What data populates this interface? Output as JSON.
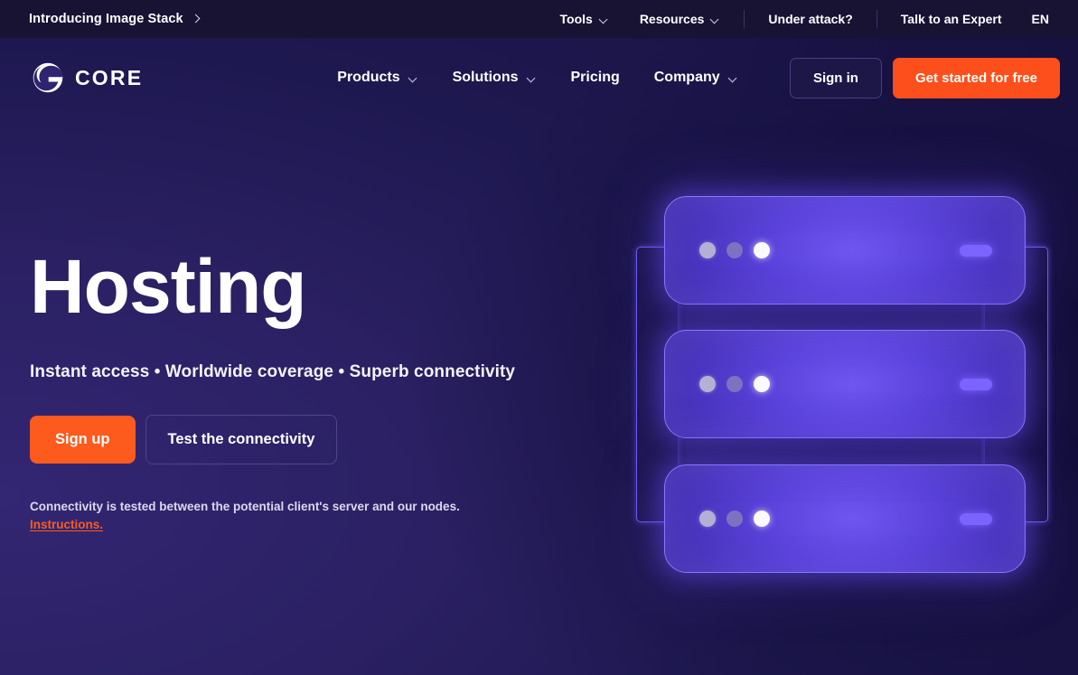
{
  "brand": {
    "name": "CORE",
    "logo_icon": "gcore-g-logo-icon",
    "accent_orange": "#fd5a1e",
    "accent_purple": "#6f56f0",
    "bg_dark_navy": "#181242",
    "bg_indigo": "#332673"
  },
  "topbar": {
    "promo_label": "Introducing Image Stack",
    "promo_icon": "chevron-right-icon",
    "items": [
      {
        "label": "Tools",
        "icon": "chevron-down-icon",
        "has_dropdown": true
      },
      {
        "label": "Resources",
        "icon": "chevron-down-icon",
        "has_dropdown": true
      },
      {
        "label": "Under attack?",
        "has_dropdown": false
      },
      {
        "label": "Talk to an Expert",
        "has_dropdown": false
      }
    ],
    "language": "EN"
  },
  "header": {
    "nav": [
      {
        "label": "Products",
        "icon": "chevron-down-icon",
        "has_dropdown": true
      },
      {
        "label": "Solutions",
        "icon": "chevron-down-icon",
        "has_dropdown": true
      },
      {
        "label": "Pricing",
        "has_dropdown": false
      },
      {
        "label": "Company",
        "icon": "chevron-down-icon",
        "has_dropdown": true
      }
    ],
    "sign_in_label": "Sign in",
    "cta_label": "Get started for free"
  },
  "hero": {
    "title": "Hosting",
    "subtitle": "Instant access • Worldwide coverage • Superb connectivity",
    "primary_button": "Sign up",
    "secondary_button": "Test the connectivity",
    "note": "Connectivity is tested between the potential client's server and our nodes.",
    "note_link": "Instructions."
  },
  "illustration": {
    "name": "server-rack-illustration",
    "servers": [
      {
        "id": "server-node-1",
        "status_dots": [
          "idle",
          "dim",
          "active"
        ],
        "indicator": "purple-pill"
      },
      {
        "id": "server-node-2",
        "status_dots": [
          "idle",
          "dim",
          "active"
        ],
        "indicator": "purple-pill"
      },
      {
        "id": "server-node-3",
        "status_dots": [
          "idle",
          "dim",
          "active"
        ],
        "indicator": "purple-pill"
      }
    ],
    "rails": [
      "left-connector-rail",
      "right-connector-rail"
    ]
  }
}
